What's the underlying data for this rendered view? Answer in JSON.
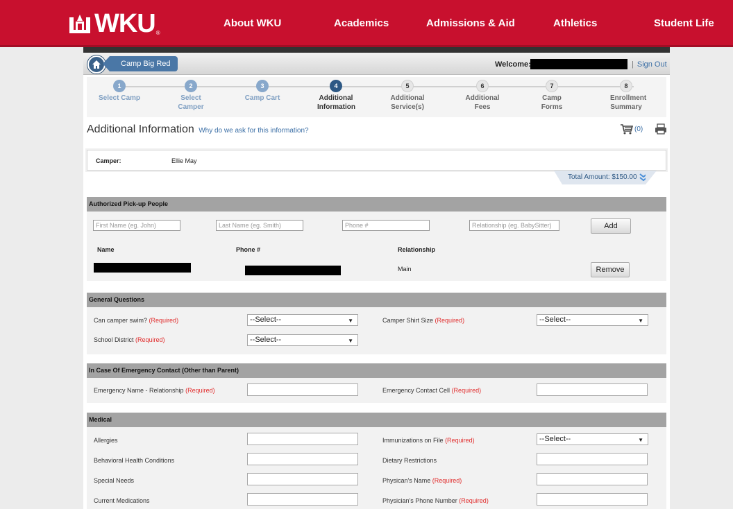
{
  "site": {
    "logo_text": "WKU",
    "nav": [
      "About WKU",
      "Academics",
      "Admissions & Aid",
      "Athletics",
      "Student Life"
    ]
  },
  "header": {
    "breadcrumb": "Camp Big Red",
    "welcome_label": "Welcome:",
    "sign_out": "Sign Out"
  },
  "steps": [
    {
      "num": "1",
      "label": "Select Camp",
      "state": "done"
    },
    {
      "num": "2",
      "label": "Select Camper",
      "state": "done"
    },
    {
      "num": "3",
      "label": "Camp Cart",
      "state": "done"
    },
    {
      "num": "4",
      "label": "Additional Information",
      "state": "current"
    },
    {
      "num": "5",
      "label": "Additional Service(s)",
      "state": "todo"
    },
    {
      "num": "6",
      "label": "Additional Fees",
      "state": "todo"
    },
    {
      "num": "7",
      "label": "Camp Forms",
      "state": "todo"
    },
    {
      "num": "8",
      "label": "Enrollment Summary",
      "state": "todo"
    }
  ],
  "page": {
    "title": "Additional Information",
    "why_link": "Why do we ask for this information?",
    "cart_count": "(0)"
  },
  "camper": {
    "label": "Camper:",
    "name": "Ellie May",
    "total": "Total Amount: $150.00"
  },
  "pickup": {
    "title": "Authorized Pick-up People",
    "first_name_ph": "First Name (eg. John)",
    "last_name_ph": "Last Name (eg. Smith)",
    "phone_ph": "Phone #",
    "relationship_ph": "Relationship (eg. BabySitter)",
    "add": "Add",
    "col_name": "Name",
    "col_phone": "Phone #",
    "col_relationship": "Relationship",
    "row_relationship": "Main",
    "remove": "Remove"
  },
  "general": {
    "title": "General Questions",
    "swim_label": "Can camper swim?",
    "shirt_label": "Camper Shirt Size",
    "district_label": "School District",
    "required": "(Required)",
    "select_default": "--Select--"
  },
  "emergency": {
    "title": "In Case Of Emergency Contact (Other than Parent)",
    "name_label": "Emergency Name - Relationship",
    "cell_label": "Emergency Contact Cell"
  },
  "medical": {
    "title": "Medical",
    "allergies": "Allergies",
    "immunizations": "Immunizations on File",
    "behavioral": "Behavioral Health Conditions",
    "dietary": "Dietary Restrictions",
    "special_needs": "Special Needs",
    "physician_name": "Physican's Name",
    "medications": "Current Medications",
    "physician_phone": "Physician's Phone Number"
  },
  "colors": {
    "brand_red": "#c8102e",
    "link_blue": "#3a6ea5",
    "required_red": "#e12c2c"
  }
}
